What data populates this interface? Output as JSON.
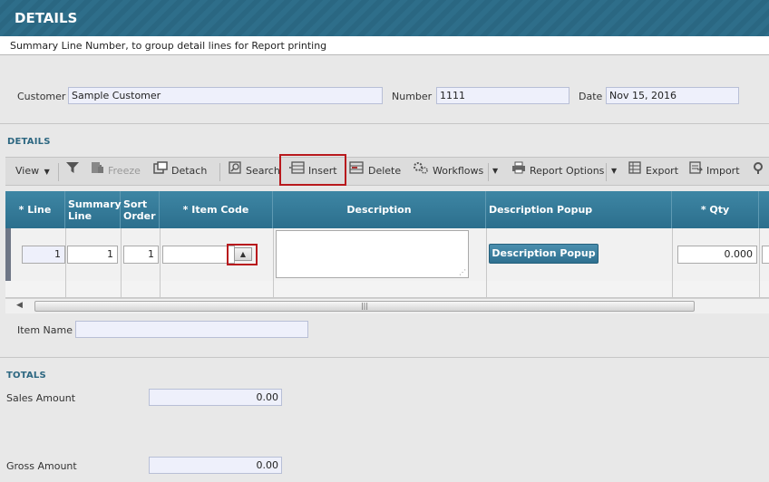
{
  "window": {
    "title": "DETAILS"
  },
  "hint": "Summary Line Number, to group detail lines for Report printing",
  "header": {
    "customer_label": "Customer",
    "customer_value": "Sample Customer",
    "number_label": "Number",
    "number_value": "1111",
    "date_label": "Date",
    "date_value": "Nov 15, 2016"
  },
  "details_section": {
    "title": "DETAILS"
  },
  "toolbar": {
    "view": "View",
    "freeze": "Freeze",
    "detach": "Detach",
    "search": "Search",
    "insert": "Insert",
    "delete": "Delete",
    "workflows": "Workflows",
    "report_options": "Report Options",
    "export": "Export",
    "import": "Import"
  },
  "grid": {
    "columns": [
      "* Line",
      "Summary Line",
      "Sort Order",
      "* Item Code",
      "Description",
      "Description Popup",
      "* Qty"
    ],
    "row": {
      "line": "1",
      "summary_line": "1",
      "sort_order": "1",
      "item_code": "",
      "description": "",
      "popup_button": "Description Popup",
      "qty": "0.000"
    }
  },
  "item_name": {
    "label": "Item Name",
    "value": ""
  },
  "totals": {
    "title": "TOTALS",
    "sales_label": "Sales Amount",
    "sales_value": "0.00",
    "gross_label": "Gross Amount",
    "gross_value": "0.00"
  },
  "colors": {
    "header_blue": "#2e6e8a",
    "accent_red": "#b8191d",
    "field_bg": "#eef0fb"
  },
  "icons": [
    "filter-icon",
    "freeze-icon",
    "detach-icon",
    "search-icon",
    "insert-icon",
    "delete-icon",
    "workflows-icon",
    "print-icon",
    "export-icon",
    "import-icon"
  ]
}
